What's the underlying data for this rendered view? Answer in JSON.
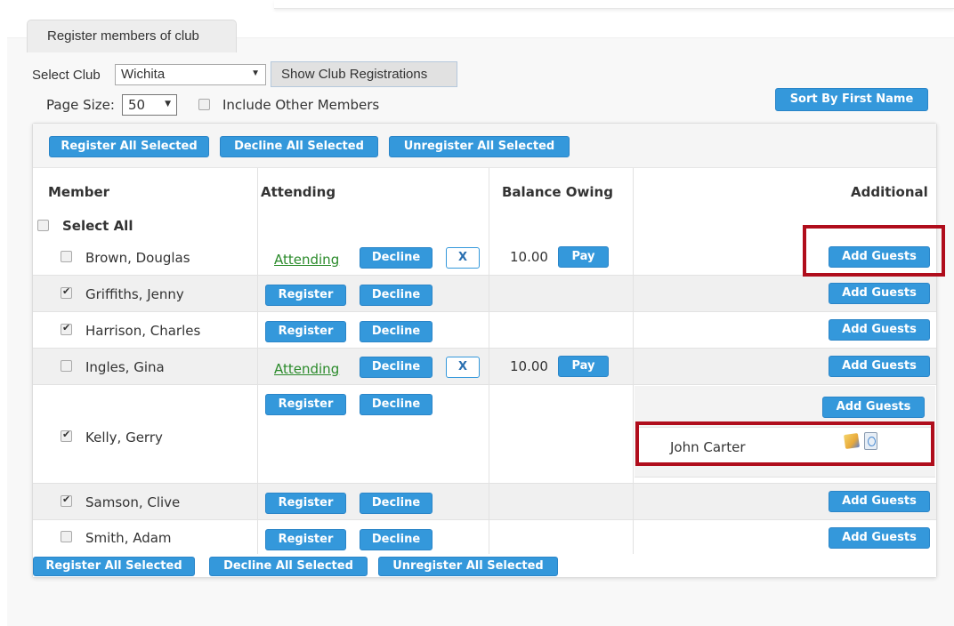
{
  "tab": {
    "label": "Register members of club"
  },
  "filters": {
    "select_club_label": "Select Club",
    "club_value": "Wichita",
    "show_button": "Show Club Registrations",
    "page_size_label": "Page Size:",
    "page_size_value": "50",
    "include_other_label": "Include Other Members",
    "sort_button": "Sort By First Name"
  },
  "toolbar": {
    "register_all": "Register All Selected",
    "decline_all": "Decline All Selected",
    "unregister_all": "Unregister All Selected"
  },
  "columns": {
    "member": "Member",
    "attending": "Attending",
    "balance": "Balance Owing",
    "additional": "Additional"
  },
  "select_all": "Select All",
  "labels": {
    "attending": "Attending",
    "decline": "Decline",
    "register": "Register",
    "x": "X",
    "pay": "Pay",
    "add_guests": "Add Guests"
  },
  "rows": [
    {
      "name": "Brown, Douglas",
      "checked": false,
      "status": "attending",
      "balance": "10.00"
    },
    {
      "name": "Griffiths, Jenny",
      "checked": true,
      "status": "none",
      "balance": ""
    },
    {
      "name": "Harrison, Charles",
      "checked": true,
      "status": "none",
      "balance": ""
    },
    {
      "name": "Ingles, Gina",
      "checked": false,
      "status": "attending",
      "balance": "10.00"
    },
    {
      "name": "Kelly, Gerry",
      "checked": true,
      "status": "none",
      "balance": "",
      "guests": [
        "John Carter"
      ]
    },
    {
      "name": "Samson, Clive",
      "checked": true,
      "status": "none",
      "balance": ""
    },
    {
      "name": "Smith, Adam",
      "checked": false,
      "status": "none",
      "balance": ""
    }
  ],
  "colors": {
    "button_blue": "#3498db",
    "attending_green": "#2a8a2a",
    "highlight_red": "#b00d1c"
  }
}
